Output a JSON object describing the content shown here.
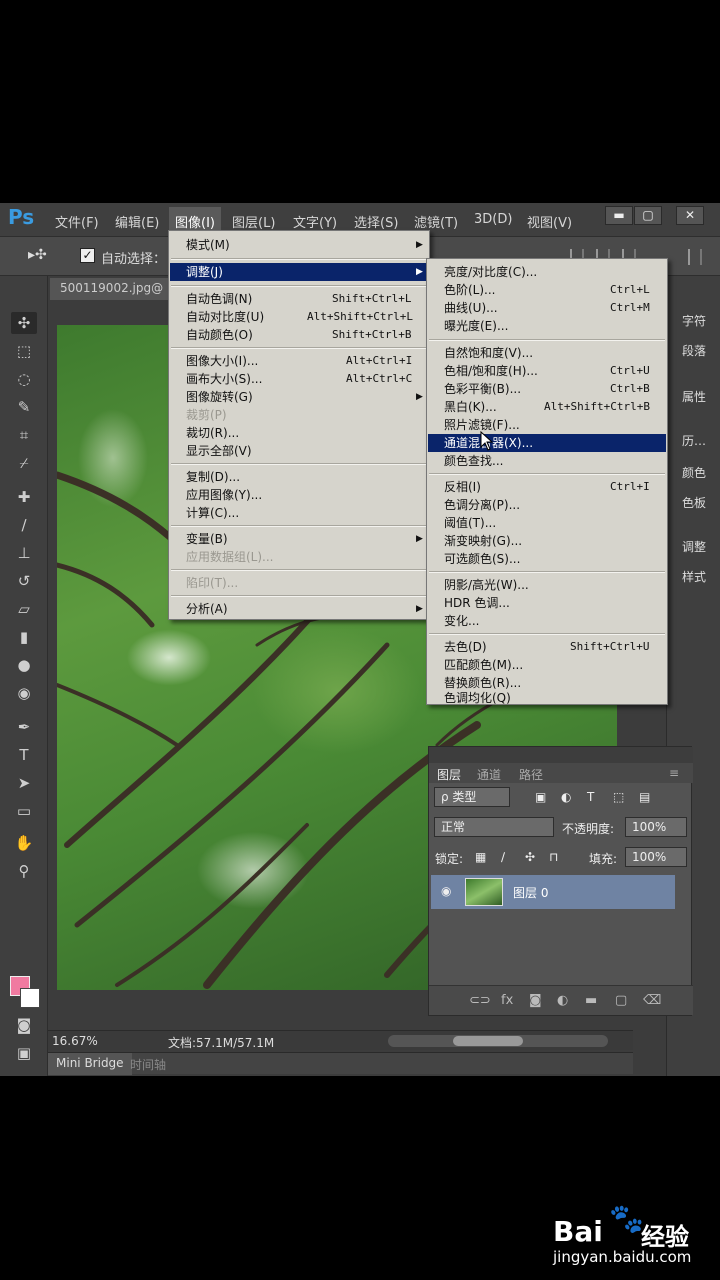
{
  "app": {
    "logo": "Ps",
    "menubar": [
      "文件(F)",
      "编辑(E)",
      "图像(I)",
      "图层(L)",
      "文字(Y)",
      "选择(S)",
      "滤镜(T)",
      "3D(D)",
      "视图(V)"
    ],
    "window_buttons": [
      "▬",
      "▢",
      "✕"
    ]
  },
  "options": {
    "move_icon": "▸✣",
    "auto_select_checked": "✓",
    "auto_select_label": "自动选择："
  },
  "document": {
    "tab_title": "500119002.jpg@",
    "zoom": "16.67%",
    "doc_size": "文档:57.1M/57.1M"
  },
  "bottom_tabs": {
    "mini_bridge": "Mini Bridge",
    "timeline": "时间轴"
  },
  "right_dock": [
    "字符",
    "段落",
    "属性",
    "历…",
    "颜色",
    "色板",
    "调整",
    "样式"
  ],
  "image_menu": [
    {
      "label": "模式(M)",
      "arrow": "▶"
    },
    {
      "label": "调整(J)",
      "arrow": "▶"
    },
    {
      "label": "自动色调(N)",
      "shortcut": "Shift+Ctrl+L"
    },
    {
      "label": "自动对比度(U)",
      "shortcut": "Alt+Shift+Ctrl+L"
    },
    {
      "label": "自动颜色(O)",
      "shortcut": "Shift+Ctrl+B"
    },
    {
      "label": "图像大小(I)...",
      "shortcut": "Alt+Ctrl+I"
    },
    {
      "label": "画布大小(S)...",
      "shortcut": "Alt+Ctrl+C"
    },
    {
      "label": "图像旋转(G)",
      "arrow": "▶"
    },
    {
      "label": "裁剪(P)"
    },
    {
      "label": "裁切(R)..."
    },
    {
      "label": "显示全部(V)"
    },
    {
      "label": "复制(D)..."
    },
    {
      "label": "应用图像(Y)..."
    },
    {
      "label": "计算(C)..."
    },
    {
      "label": "变量(B)",
      "arrow": "▶"
    },
    {
      "label": "应用数据组(L)..."
    },
    {
      "label": "陷印(T)..."
    },
    {
      "label": "分析(A)",
      "arrow": "▶"
    }
  ],
  "adjust_menu": [
    {
      "label": "亮度/对比度(C)..."
    },
    {
      "label": "色阶(L)...",
      "shortcut": "Ctrl+L"
    },
    {
      "label": "曲线(U)...",
      "shortcut": "Ctrl+M"
    },
    {
      "label": "曝光度(E)..."
    },
    {
      "label": "自然饱和度(V)..."
    },
    {
      "label": "色相/饱和度(H)...",
      "shortcut": "Ctrl+U"
    },
    {
      "label": "色彩平衡(B)...",
      "shortcut": "Ctrl+B"
    },
    {
      "label": "黑白(K)...",
      "shortcut": "Alt+Shift+Ctrl+B"
    },
    {
      "label": "照片滤镜(F)..."
    },
    {
      "label": "通道混合器(X)..."
    },
    {
      "label": "颜色查找..."
    },
    {
      "label": "反相(I)",
      "shortcut": "Ctrl+I"
    },
    {
      "label": "色调分离(P)..."
    },
    {
      "label": "阈值(T)..."
    },
    {
      "label": "渐变映射(G)..."
    },
    {
      "label": "可选颜色(S)..."
    },
    {
      "label": "阴影/高光(W)..."
    },
    {
      "label": "HDR 色调..."
    },
    {
      "label": "变化..."
    },
    {
      "label": "去色(D)",
      "shortcut": "Shift+Ctrl+U"
    },
    {
      "label": "匹配颜色(M)..."
    },
    {
      "label": "替换颜色(R)..."
    },
    {
      "label": "色调均化(Q)"
    }
  ],
  "layers": {
    "tabs": [
      "图层",
      "通道",
      "路径"
    ],
    "filter_kind": "ρ 类型",
    "blend_mode": "正常",
    "opacity_label": "不透明度:",
    "opacity": "100%",
    "lock_label": "锁定:",
    "fill_label": "填充:",
    "fill": "100%",
    "layer_name": "图层 0"
  },
  "watermark": {
    "bai": "Bai",
    "jingyan": "经验",
    "url": "jingyan.baidu.com"
  }
}
